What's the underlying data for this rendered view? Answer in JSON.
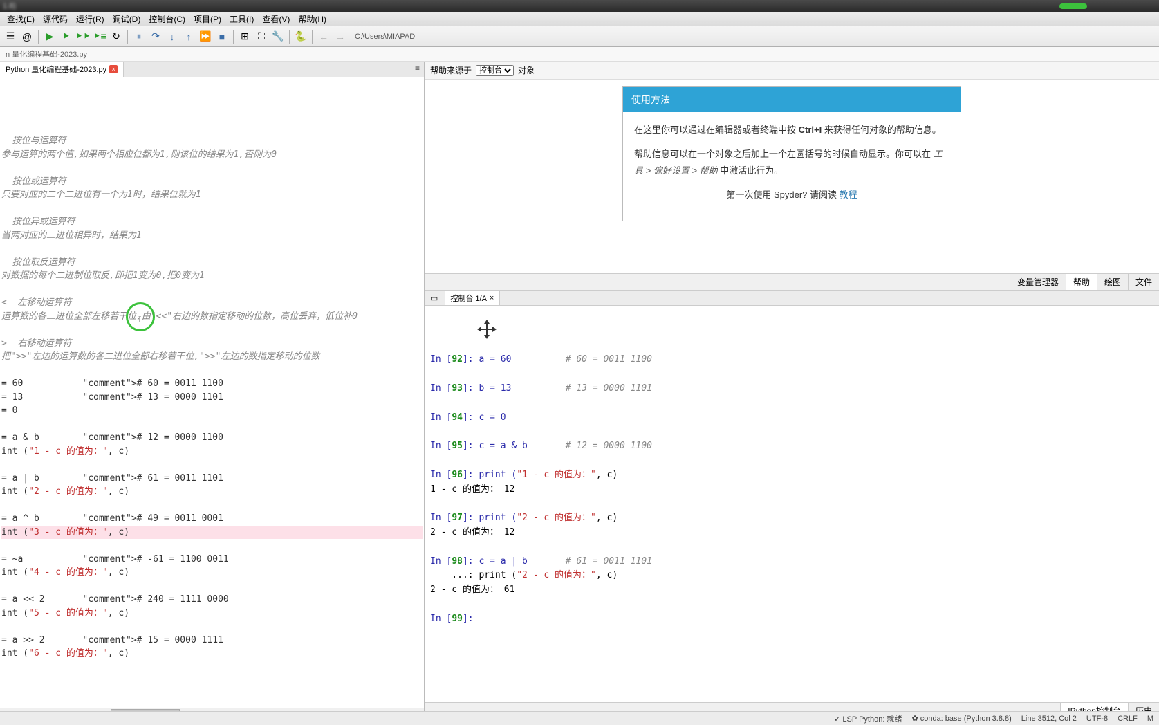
{
  "title_blur": "1.8)",
  "menus": [
    "查找(E)",
    "源代码",
    "运行(R)",
    "调试(D)",
    "控制台(C)",
    "项目(P)",
    "工具(I)",
    "查看(V)",
    "帮助(H)"
  ],
  "path": "C:\\Users\\MIAPAD",
  "breadcrumb": "n 量化编程基础-2023.py",
  "editor_tab": "Python 量化编程基础-2023.py",
  "editor_lines": [
    {
      "t": "  按位与运算符",
      "c": "comment"
    },
    {
      "t": "参与运算的两个值,如果两个相应位都为1,则该位的结果为1,否则为0",
      "c": "comment"
    },
    {
      "t": ""
    },
    {
      "t": "  按位或运算符",
      "c": "comment"
    },
    {
      "t": "只要对应的二个二进位有一个为1时，结果位就为1",
      "c": "comment"
    },
    {
      "t": ""
    },
    {
      "t": "  按位异或运算符",
      "c": "comment"
    },
    {
      "t": "当两对应的二进位相异时，结果为1",
      "c": "comment"
    },
    {
      "t": ""
    },
    {
      "t": "  按位取反运算符",
      "c": "comment"
    },
    {
      "t": "对数据的每个二进制位取反,即把1变为0,把0变为1",
      "c": "comment"
    },
    {
      "t": ""
    },
    {
      "t": "<  左移动运算符",
      "c": "comment"
    },
    {
      "t": "运算数的各二进位全部左移若干位,由\"<<\"右边的数指定移动的位数，高位丢弃，低位补0",
      "c": "comment"
    },
    {
      "t": ""
    },
    {
      "t": ">  右移动运算符",
      "c": "comment"
    },
    {
      "t": "把\">>\"左边的运算数的各二进位全部右移若干位,\">>\"左边的数指定移动的位数",
      "c": "comment"
    },
    {
      "t": ""
    },
    {
      "t": "= 60           # 60 = 0011 1100",
      "c": "code"
    },
    {
      "t": "= 13           # 13 = 0000 1101",
      "c": "code"
    },
    {
      "t": "= 0",
      "c": "code"
    },
    {
      "t": ""
    },
    {
      "t": "= a & b        # 12 = 0000 1100",
      "c": "code"
    },
    {
      "t": "int (\"1 - c 的值为：\", c)",
      "c": "code"
    },
    {
      "t": ""
    },
    {
      "t": "= a | b        # 61 = 0011 1101",
      "c": "code"
    },
    {
      "t": "int (\"2 - c 的值为：\", c)",
      "c": "code"
    },
    {
      "t": ""
    },
    {
      "t": "= a ^ b        # 49 = 0011 0001",
      "c": "code"
    },
    {
      "t": "int (\"3 - c 的值为：\", c)",
      "c": "code",
      "hl": true
    },
    {
      "t": ""
    },
    {
      "t": "= ~a           # -61 = 1100 0011",
      "c": "code"
    },
    {
      "t": "int (\"4 - c 的值为：\", c)",
      "c": "code"
    },
    {
      "t": ""
    },
    {
      "t": "= a << 2       # 240 = 1111 0000",
      "c": "code"
    },
    {
      "t": "int (\"5 - c 的值为：\", c)",
      "c": "code"
    },
    {
      "t": ""
    },
    {
      "t": "= a >> 2       # 15 = 0000 1111",
      "c": "code"
    },
    {
      "t": "int (\"6 - c 的值为：\", c)",
      "c": "code"
    }
  ],
  "help": {
    "source_label": "帮助来源于",
    "source_value": "控制台",
    "object_label": "对象",
    "card_title": "使用方法",
    "card_body1_pre": "在这里你可以通过在编辑器或者终端中按 ",
    "card_body1_key": "Ctrl+I",
    "card_body1_post": " 来获得任何对象的帮助信息。",
    "card_body2_pre": "帮助信息可以在一个对象之后加上一个左圆括号的时候自动显示。你可以在 ",
    "card_body2_i": "工具 > 偏好设置 > 帮助",
    "card_body2_post": " 中激活此行为。",
    "footer_text": "第一次使用 Spyder? 请阅读 ",
    "footer_link": "教程"
  },
  "right_tabs": [
    "变量管理器",
    "帮助",
    "绘图",
    "文件"
  ],
  "console_tab": "控制台 1/A",
  "console": [
    {
      "p": "In [",
      "n": "92",
      "s": "]: a = 60",
      "cm": "          # 60 = 0011 1100"
    },
    {
      "raw": ""
    },
    {
      "p": "In [",
      "n": "93",
      "s": "]: b = 13",
      "cm": "          # 13 = 0000 1101"
    },
    {
      "raw": ""
    },
    {
      "p": "In [",
      "n": "94",
      "s": "]: c = 0"
    },
    {
      "raw": ""
    },
    {
      "p": "In [",
      "n": "95",
      "s": "]: c = a & b",
      "cm": "       # 12 = 0000 1100"
    },
    {
      "raw": ""
    },
    {
      "p": "In [",
      "n": "96",
      "s": "]: print (",
      "str": "\"1 - c 的值为：\"",
      "s2": ", c)"
    },
    {
      "raw": "1 - c 的值为： 12"
    },
    {
      "raw": ""
    },
    {
      "p": "In [",
      "n": "97",
      "s": "]: print (",
      "str": "\"2 - c 的值为：\"",
      "s2": ", c)"
    },
    {
      "raw": "2 - c 的值为： 12"
    },
    {
      "raw": ""
    },
    {
      "p": "In [",
      "n": "98",
      "s": "]: c = a | b",
      "cm": "       # 61 = 0011 1101"
    },
    {
      "raw": "    ...: print (",
      "str": "\"2 - c 的值为：\"",
      "s2": ", c)"
    },
    {
      "raw": "2 - c 的值为： 61"
    },
    {
      "raw": ""
    },
    {
      "p": "In [",
      "n": "99",
      "s": "]: "
    }
  ],
  "bottom_tabs": [
    "IPython控制台",
    "历史"
  ],
  "status": {
    "lsp": "✓ LSP Python: 就绪",
    "conda": "✿ conda: base (Python 3.8.8)",
    "pos": "Line 3512, Col 2",
    "enc": "UTF-8",
    "eol": "CRLF",
    "mem": "M"
  }
}
